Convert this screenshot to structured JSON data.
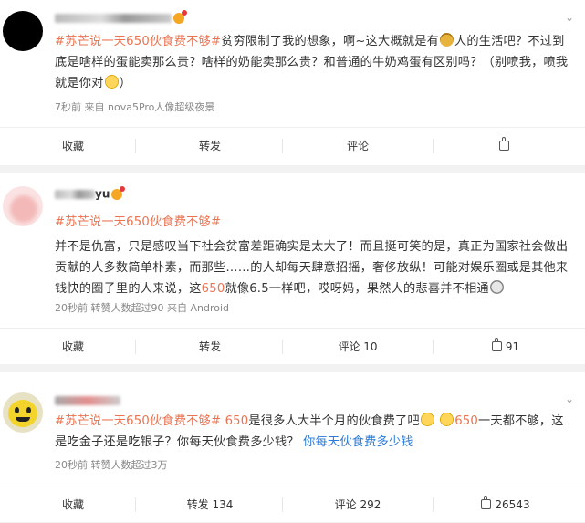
{
  "posts": [
    {
      "hashtag": "#苏芒说一天650伙食费不够#",
      "text_before_emoji": "贫穷限制了我的想象，啊~这大概就是有",
      "emoji1": "money-bag-emoji",
      "text_middle": "人的生活吧？不过到底是啥样的蛋能卖那么贵？啥样的奶能卖那么贵？和普通的牛奶鸡蛋有区别吗？（别喷我，喷我就是你对",
      "emoji2": "grin-face-emoji",
      "text_after_emoji": "）",
      "meta": "7秒前  来自 nova5Pro人像超级夜景",
      "actions": {
        "collect": "收藏",
        "repost": "转发",
        "comment": "评论",
        "like": ""
      }
    },
    {
      "username_suffix": "yu",
      "hashtag": "#苏芒说一天650伙食费不够#",
      "text_part1": "并不是仇富，只是感叹当下社会贫富差距确实是太大了！而且挺可笑的是，真正为国家社会做出贡献的人多数简单朴素，而那些……的人却每天肆意招摇，奢侈放纵！可能对娱乐圈或是其他来钱快的圈子里的人来说，这",
      "text_hot": "650",
      "text_part2": "就像6.5一样吧，哎呀妈，果然人的悲喜并不相通",
      "emoji": "sweat-face-emoji",
      "meta": "20秒前  转赞人数超过90  来自 Android",
      "actions": {
        "collect": "收藏",
        "repost": "转发",
        "comment": "评论 10",
        "like": "91"
      }
    },
    {
      "hashtag": "#苏芒说一天650伙食费不够#",
      "text_hot1": "650",
      "text_part1": "是很多人大半个月的伙食费了吧",
      "emoji_a": "yummy-face-emoji",
      "emoji_b": "yummy-face-emoji",
      "text_hot2": "650",
      "text_part2": "一天都不够，这是吃金子还是吃银子？你每天伙食费多少钱？",
      "link_text": "你每天伙食费多少钱",
      "meta": "20秒前  转赞人数超过3万",
      "actions": {
        "collect": "收藏",
        "repost": "转发 134",
        "comment": "评论 292",
        "like": "26543"
      }
    }
  ]
}
